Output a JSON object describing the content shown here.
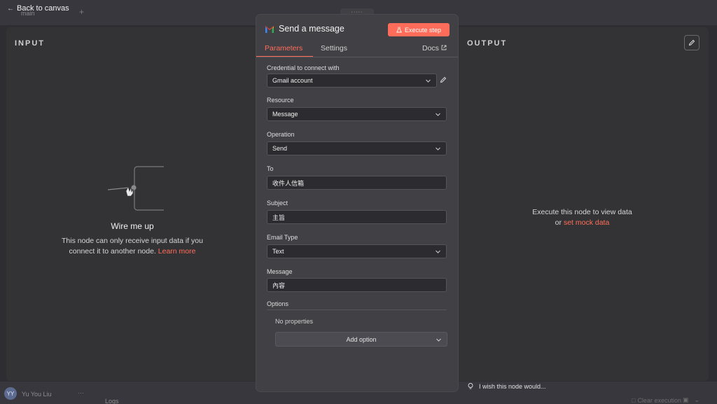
{
  "app": {
    "back_label": "Back to canvas",
    "bg_tab_label": "main"
  },
  "input_pane": {
    "title": "INPUT",
    "wire_title": "Wire me up",
    "wire_text": "This node can only receive input data if you connect it to another node.",
    "learn_more": "Learn more"
  },
  "output_pane": {
    "title": "OUTPUT",
    "line1": "Execute this node to view data",
    "line2_prefix": "or",
    "mock_link": "set mock data"
  },
  "node": {
    "title": "Send a message",
    "execute_label": "Execute step",
    "tabs": {
      "parameters": "Parameters",
      "settings": "Settings",
      "docs": "Docs"
    },
    "fields": {
      "credential": {
        "label": "Credential to connect with",
        "value": "Gmail account"
      },
      "resource": {
        "label": "Resource",
        "value": "Message"
      },
      "operation": {
        "label": "Operation",
        "value": "Send"
      },
      "to": {
        "label": "To",
        "value": "收件人信箱"
      },
      "subject": {
        "label": "Subject",
        "value": "主旨"
      },
      "email_type": {
        "label": "Email Type",
        "value": "Text"
      },
      "message": {
        "label": "Message",
        "value": "內容"
      }
    },
    "options": {
      "label": "Options",
      "empty": "No properties",
      "add_label": "Add option"
    }
  },
  "footer": {
    "feedback": "I wish this node would...",
    "user_initials": "YY",
    "user_name": "Yu You Liu",
    "logs": "Logs",
    "clear": "Clear execution"
  },
  "colors": {
    "accent": "#ff6d5a",
    "modal_bg": "#414045",
    "page_bg": "#2e2e32"
  }
}
